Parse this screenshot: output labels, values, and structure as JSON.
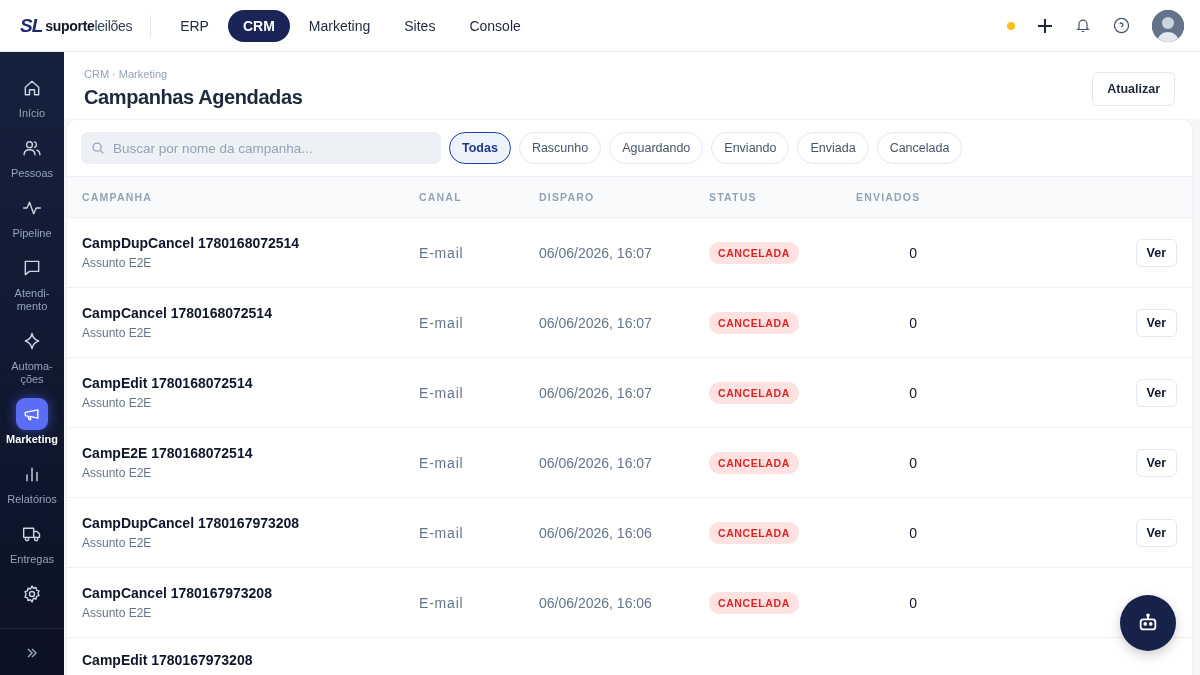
{
  "brand": {
    "mark": "SL",
    "name_bold": "suporte",
    "name_light": "leilões"
  },
  "top_nav": [
    {
      "label": "ERP",
      "selected": false
    },
    {
      "label": "CRM",
      "selected": true
    },
    {
      "label": "Marketing",
      "selected": false
    },
    {
      "label": "Sites",
      "selected": false
    },
    {
      "label": "Console",
      "selected": false
    }
  ],
  "status_dot": {
    "color": "#fbbf24"
  },
  "sidebar": {
    "items": [
      {
        "label": "Início",
        "selected": false
      },
      {
        "label": "Pessoas",
        "selected": false
      },
      {
        "label": "Pipeline",
        "selected": false
      },
      {
        "label": "Atendi-mento",
        "selected": false
      },
      {
        "label": "Automa-ções",
        "selected": false
      },
      {
        "label": "Marketing",
        "selected": true
      },
      {
        "label": "Relatórios",
        "selected": false
      },
      {
        "label": "Entregas",
        "selected": false
      },
      {
        "selected": false
      }
    ]
  },
  "breadcrumb": "CRM · Marketing",
  "page_title": "Campanhas Agendadas",
  "refresh_button": "Atualizar",
  "search": {
    "placeholder": "Buscar por nome da campanha..."
  },
  "filters": [
    {
      "label": "Todas",
      "selected": true
    },
    {
      "label": "Rascunho",
      "selected": false
    },
    {
      "label": "Aguardando",
      "selected": false
    },
    {
      "label": "Enviando",
      "selected": false
    },
    {
      "label": "Enviada",
      "selected": false
    },
    {
      "label": "Cancelada",
      "selected": false
    }
  ],
  "table": {
    "columns": [
      "CAMPANHA",
      "CANAL",
      "DISPARO",
      "STATUS",
      "ENVIADOS"
    ],
    "rows": [
      {
        "name": "CampDupCancel 1780168072514",
        "subject": "Assunto E2E",
        "channel": "E-mail",
        "sent_at": "06/06/2026, 16:07",
        "status": {
          "kind": "cancelled",
          "label": "CANCELADA"
        },
        "sent": "0",
        "action": "Ver"
      },
      {
        "name": "CampCancel 1780168072514",
        "subject": "Assunto E2E",
        "channel": "E-mail",
        "sent_at": "06/06/2026, 16:07",
        "status": {
          "kind": "cancelled",
          "label": "CANCELADA"
        },
        "sent": "0",
        "action": "Ver"
      },
      {
        "name": "CampEdit 1780168072514",
        "subject": "Assunto E2E",
        "channel": "E-mail",
        "sent_at": "06/06/2026, 16:07",
        "status": {
          "kind": "cancelled",
          "label": "CANCELADA"
        },
        "sent": "0",
        "action": "Ver"
      },
      {
        "name": "CampE2E 1780168072514",
        "subject": "Assunto E2E",
        "channel": "E-mail",
        "sent_at": "06/06/2026, 16:07",
        "status": {
          "kind": "cancelled",
          "label": "CANCELADA"
        },
        "sent": "0",
        "action": "Ver"
      },
      {
        "name": "CampDupCancel 1780167973208",
        "subject": "Assunto E2E",
        "channel": "E-mail",
        "sent_at": "06/06/2026, 16:06",
        "status": {
          "kind": "cancelled",
          "label": "CANCELADA"
        },
        "sent": "0",
        "action": "Ver"
      },
      {
        "name": "CampCancel 1780167973208",
        "subject": "Assunto E2E",
        "channel": "E-mail",
        "sent_at": "06/06/2026, 16:06",
        "status": {
          "kind": "cancelled",
          "label": "CANCELADA"
        },
        "sent": "0"
      },
      {
        "name": "CampEdit 1780167973208"
      }
    ]
  }
}
